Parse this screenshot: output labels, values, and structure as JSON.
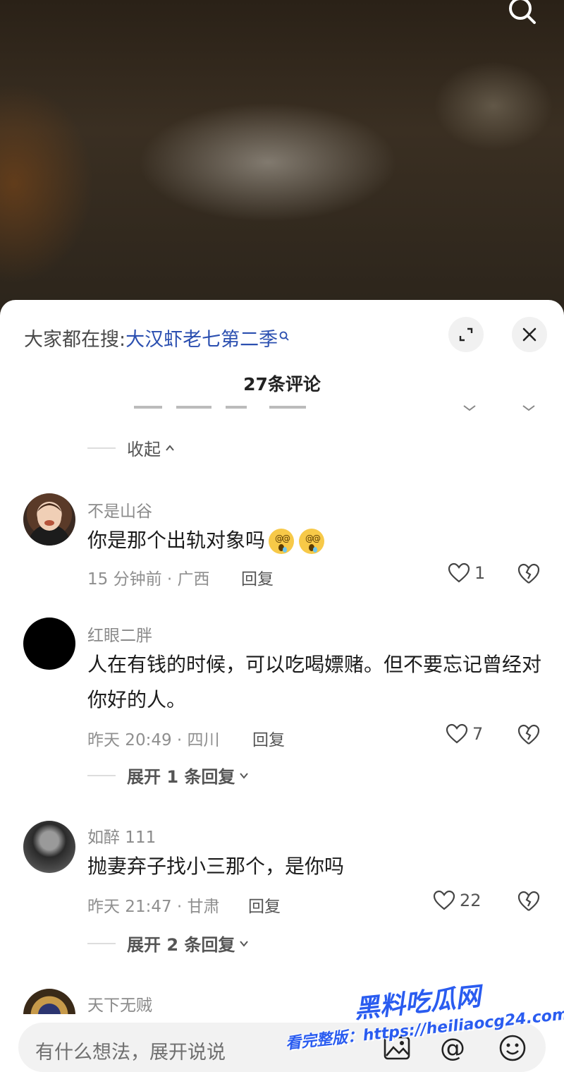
{
  "hot_search": {
    "prefix": "大家都在搜:",
    "term": "大汉虾老七第二季"
  },
  "comment_count": "27条评论",
  "collapse_label": "收起",
  "comments": [
    {
      "username": "不是山谷",
      "content": "你是那个出轨对象吗",
      "meta": "15 分钟前 · 广西",
      "reply": "回复",
      "likes": "1",
      "emojis": [
        "dizzy-face-emoji",
        "dizzy-face-emoji"
      ]
    },
    {
      "username": "红眼二胖",
      "content": "人在有钱的时候，可以吃喝嫖赌。但不要忘记曾经对你好的人。",
      "meta": "昨天 20:49 · 四川",
      "reply": "回复",
      "likes": "7",
      "expand": "展开 1 条回复"
    },
    {
      "username": "如醉 111",
      "content": "抛妻弃子找小三那个，是你吗",
      "meta": "昨天 21:47 · 甘肃",
      "reply": "回复",
      "likes": "22",
      "expand": "展开 2 条回复"
    },
    {
      "username": "天下无贼"
    }
  ],
  "input": {
    "placeholder": "有什么想法，展开说说"
  },
  "watermark": {
    "title": "黑料吃瓜网",
    "url": "看完整版：https://heiliaocg24.com"
  },
  "colors": {
    "link": "#2b4fb0",
    "watermark": "#2a5cf0"
  }
}
